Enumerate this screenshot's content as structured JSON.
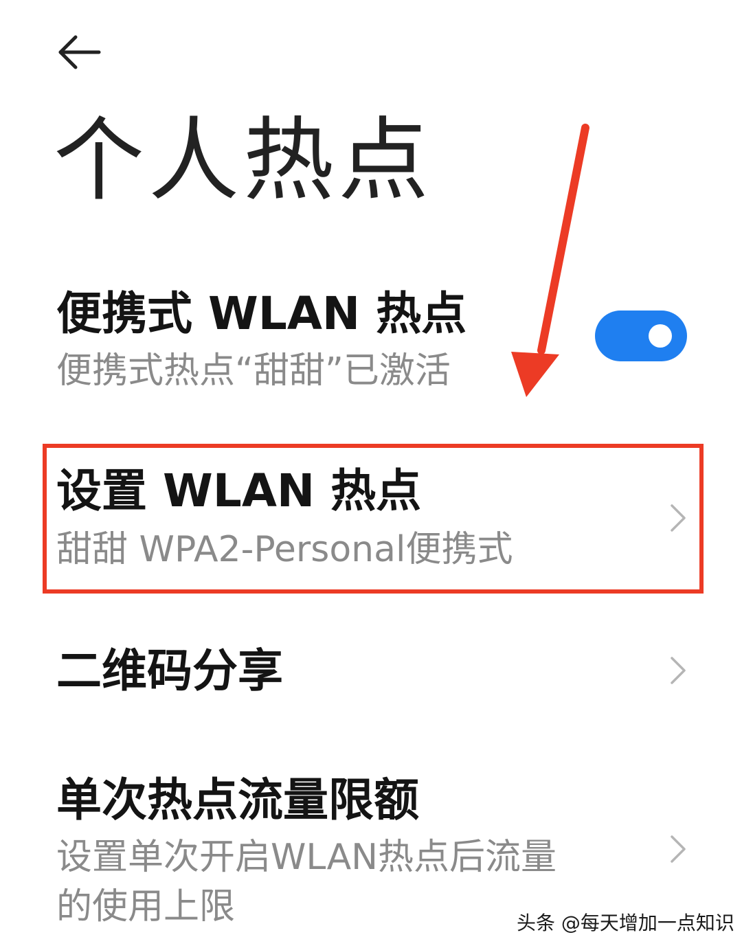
{
  "header": {
    "back_icon": "back-arrow-icon",
    "title": "个人热点"
  },
  "hotspot": {
    "title": "便携式 WLAN 热点",
    "subtitle": "便携式热点“甜甜”已激活",
    "toggle_on": true,
    "toggle_color": "#1f7ff0"
  },
  "setup": {
    "title": "设置 WLAN 热点",
    "subtitle": "甜甜 WPA2-Personal便携式",
    "chevron_icon": "chevron-right-icon"
  },
  "qr_share": {
    "title": "二维码分享",
    "chevron_icon": "chevron-right-icon"
  },
  "data_limit": {
    "title": "单次热点流量限额",
    "subtitle_line1": "设置单次开启WLAN热点后流量",
    "subtitle_line2": "的使用上限",
    "chevron_icon": "chevron-right-icon"
  },
  "annotation": {
    "color": "#ec3b25"
  },
  "watermark": "头条 @每天增加一点知识"
}
